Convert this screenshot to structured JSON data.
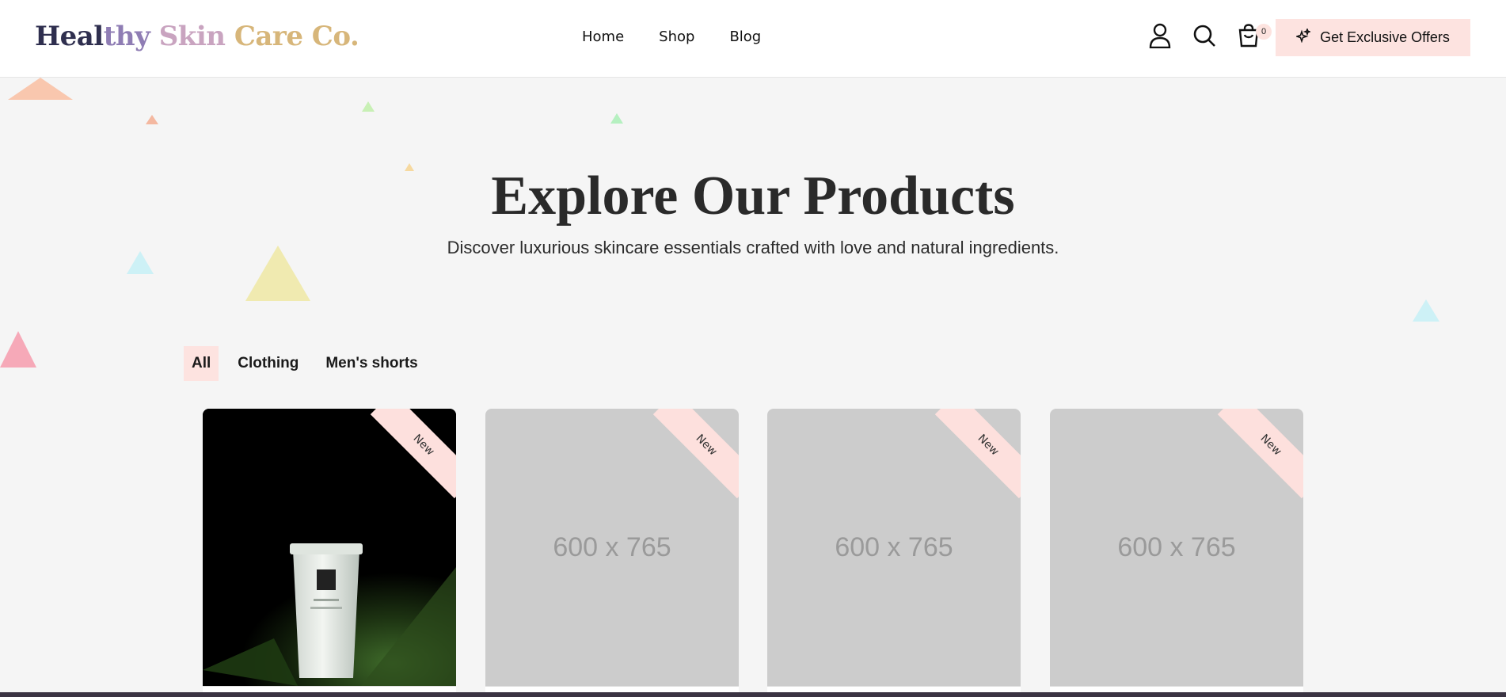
{
  "header": {
    "logo_parts": [
      {
        "text": "Heal",
        "color": "#2f2f4f"
      },
      {
        "text": "thy ",
        "color": "#8f7db4"
      },
      {
        "text": "Skin ",
        "color": "#c9a4c0"
      },
      {
        "text": "Care Co.",
        "color": "#d7b67a"
      }
    ],
    "nav": [
      {
        "label": "Home",
        "active": false
      },
      {
        "label": "Shop",
        "active": true
      },
      {
        "label": "Blog",
        "active": false
      }
    ],
    "icons": [
      "user-icon",
      "search-icon",
      "cart-icon"
    ],
    "cart_count": "0",
    "offers_label": "Get Exclusive Offers",
    "offers_icon": "sparkle-icon"
  },
  "hero": {
    "title": "Explore Our Products",
    "subtitle": "Discover luxurious skincare essentials crafted with love and natural ingredients."
  },
  "filters": [
    {
      "label": "All",
      "active": true
    },
    {
      "label": "Clothing",
      "active": false
    },
    {
      "label": "Men's shorts",
      "active": false
    }
  ],
  "products": [
    {
      "badge": "New",
      "image": "photo",
      "placeholder": ""
    },
    {
      "badge": "New",
      "image": "placeholder",
      "placeholder": "600 x 765"
    },
    {
      "badge": "New",
      "image": "placeholder",
      "placeholder": "600 x 765"
    },
    {
      "badge": "New",
      "image": "placeholder",
      "placeholder": "600 x 765"
    }
  ],
  "colors": {
    "accent": "#fde3e0",
    "background": "#f5f5f5",
    "placeholder": "#cccccc",
    "triangles": [
      "#f9c7ae",
      "#f4b8a0",
      "#c8f0b5",
      "#b5f0c0",
      "#f6d9a0",
      "#cdf1f6",
      "#f0eab0",
      "#f6a9b8",
      "#cdf1f6"
    ]
  }
}
